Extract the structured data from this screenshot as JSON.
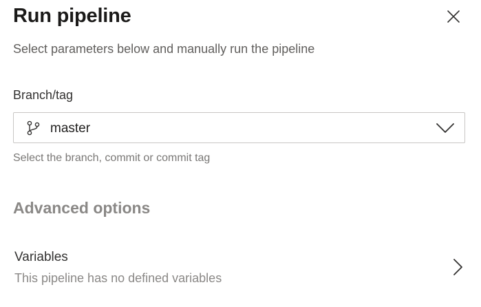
{
  "panel": {
    "title": "Run pipeline",
    "subtitle": "Select parameters below and manually run the pipeline"
  },
  "branch_field": {
    "label": "Branch/tag",
    "value": "master",
    "helper": "Select the branch, commit or commit tag",
    "icon": "git-branch-icon"
  },
  "advanced": {
    "heading": "Advanced options"
  },
  "variables": {
    "title": "Variables",
    "description": "This pipeline has no defined variables"
  },
  "colors": {
    "title_text": "#1b1a19",
    "secondary_text": "#605e5c",
    "muted_text": "#8a8886",
    "border": "#c8c6c4"
  }
}
